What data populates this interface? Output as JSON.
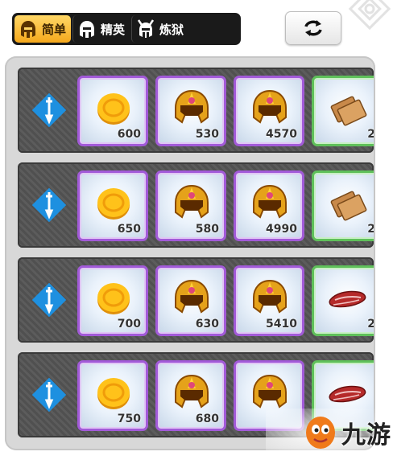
{
  "tabs": [
    {
      "label": "简单",
      "icon": "helmet-icon",
      "active": true
    },
    {
      "label": "精英",
      "icon": "helmet-icon",
      "active": false
    },
    {
      "label": "炼狱",
      "icon": "horned-helmet-icon",
      "active": false
    }
  ],
  "refresh": {
    "icon": "refresh-icon"
  },
  "rows": [
    {
      "icon": "sword-diamond-icon",
      "items": [
        {
          "icon": "gold-coin-icon",
          "qty": "600"
        },
        {
          "icon": "gold-helmet-icon",
          "qty": "530"
        },
        {
          "icon": "gold-helmet-icon",
          "qty": "4570"
        },
        {
          "icon": "crackers-icon",
          "qty": "2"
        }
      ]
    },
    {
      "icon": "sword-diamond-icon",
      "items": [
        {
          "icon": "gold-coin-icon",
          "qty": "650"
        },
        {
          "icon": "gold-helmet-icon",
          "qty": "580"
        },
        {
          "icon": "gold-helmet-icon",
          "qty": "4990"
        },
        {
          "icon": "crackers-icon",
          "qty": "2"
        }
      ]
    },
    {
      "icon": "sword-diamond-icon",
      "items": [
        {
          "icon": "gold-coin-icon",
          "qty": "700"
        },
        {
          "icon": "gold-helmet-icon",
          "qty": "630"
        },
        {
          "icon": "gold-helmet-icon",
          "qty": "5410"
        },
        {
          "icon": "meat-icon",
          "qty": "2"
        }
      ]
    },
    {
      "icon": "sword-diamond-icon",
      "items": [
        {
          "icon": "gold-coin-icon",
          "qty": "750"
        },
        {
          "icon": "gold-helmet-icon",
          "qty": "680"
        },
        {
          "icon": "gold-helmet-icon",
          "qty": ""
        },
        {
          "icon": "meat-icon",
          "qty": ""
        }
      ]
    }
  ],
  "watermark": {
    "text": "九游",
    "icon": "mascot-logo-icon"
  }
}
